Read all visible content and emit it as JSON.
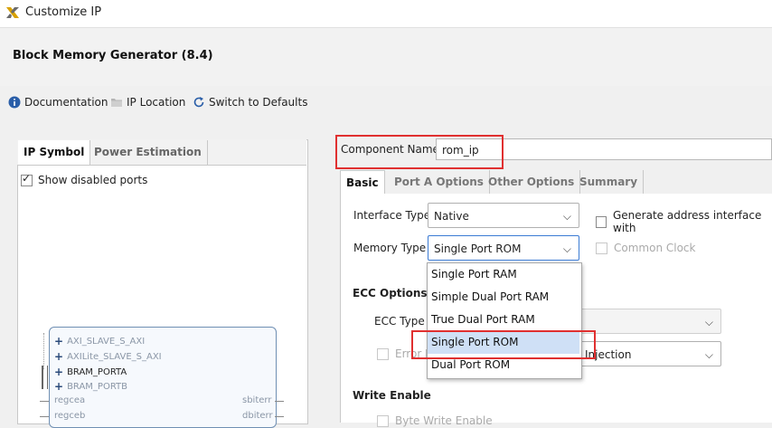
{
  "window": {
    "title": "Customize IP"
  },
  "ip": {
    "title": "Block Memory Generator (8.4)"
  },
  "toolbar": {
    "documentation": "Documentation",
    "ip_location": "IP Location",
    "switch_defaults": "Switch to Defaults"
  },
  "left_tabs": {
    "ip_symbol": "IP Symbol",
    "power_estimation": "Power Estimation"
  },
  "show_disabled_ports": {
    "label": "Show disabled ports",
    "checked": true
  },
  "symbol": {
    "interfaces": [
      "AXI_SLAVE_S_AXI",
      "AXILite_SLAVE_S_AXI",
      "BRAM_PORTA",
      "BRAM_PORTB"
    ],
    "left_ports": [
      "regcea",
      "regceb"
    ],
    "right_ports": [
      "sbiterr",
      "dbiterr"
    ]
  },
  "component": {
    "label": "Component Name",
    "value": "rom_ip"
  },
  "right_tabs": {
    "basic": "Basic",
    "port_a": "Port A Options",
    "other": "Other Options",
    "summary": "Summary"
  },
  "interface_type": {
    "label": "Interface Type",
    "value": "Native"
  },
  "generate_address": {
    "label": "Generate address interface with"
  },
  "memory_type": {
    "label": "Memory Type",
    "value": "Single Port ROM",
    "options": [
      "Single Port RAM",
      "Simple Dual Port RAM",
      "True Dual Port RAM",
      "Single Port ROM",
      "Dual Port ROM"
    ]
  },
  "common_clock": {
    "label": "Common Clock"
  },
  "ecc": {
    "section": "ECC Options",
    "type_label": "ECC Type",
    "error_label": "Error In",
    "injection_value": "Injection"
  },
  "write_enable": {
    "section": "Write Enable",
    "byte_write": "Byte Write Enable"
  },
  "colors": {
    "highlight_red": "#e03030",
    "selection_blue": "#cfe0f6",
    "focus_blue": "#3b7bd4"
  }
}
